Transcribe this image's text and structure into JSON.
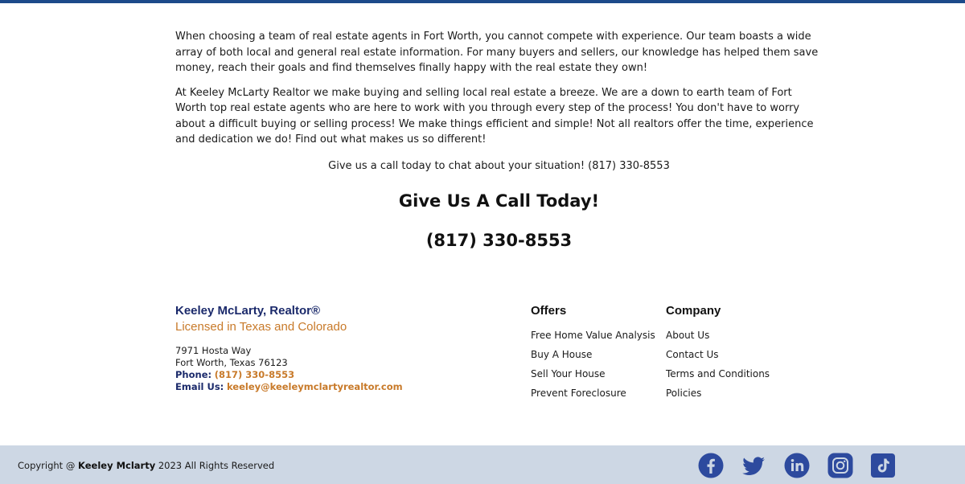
{
  "body": {
    "paragraph_1": "When choosing a team of real estate agents in Fort Worth, you cannot compete with experience. Our team boasts a wide array of both local and general real estate information. For many buyers and sellers, our knowledge has helped them save money, reach their goals and find themselves finally happy with the real estate they own!",
    "paragraph_2": "At Keeley McLarty Realtor we make buying and selling local real estate a breeze. We are a down to earth team of Fort Worth top real estate agents who are here to work with you through every step of the process! You don't have to worry about a difficult buying or selling process! We make things efficient and simple! Not all realtors offer the time, experience and dedication we do! Find out what makes us so different!",
    "call_line": "Give us a call today to chat about your situation! (817) 330-8553",
    "cta_heading": "Give Us A Call Today!",
    "cta_phone": "(817) 330-8553"
  },
  "footer": {
    "brand_name": "Keeley McLarty, Realtor®",
    "brand_tagline": "Licensed in Texas and Colorado",
    "address_line_1": "7971 Hosta Way",
    "address_line_2": "Fort Worth, Texas 76123",
    "phone_label": "Phone:",
    "phone_value": "(817) 330-8553",
    "email_label": "Email Us:",
    "email_value": "keeley@keeleymclartyrealtor.com",
    "offers": {
      "title": "Offers",
      "links": [
        "Free Home Value Analysis",
        "Buy A House",
        "Sell Your House",
        "Prevent Foreclosure"
      ]
    },
    "company": {
      "title": "Company",
      "links": [
        "About Us",
        "Contact Us",
        "Terms and Conditions",
        "Policies"
      ]
    }
  },
  "bottom_bar": {
    "copyright_prefix": "Copyright @ ",
    "copyright_name": "Keeley Mclarty",
    "copyright_suffix": " 2023 All Rights Reserved",
    "social_icons": [
      "facebook-icon",
      "twitter-icon",
      "linkedin-icon",
      "instagram-icon",
      "tiktok-icon"
    ]
  },
  "colors": {
    "top_bar": "#1d4a8a",
    "brand_navy": "#1b2a6b",
    "accent_orange": "#c87a2a",
    "footer_bg": "#cdd7e4",
    "social_blue": "#2d4a9e"
  }
}
